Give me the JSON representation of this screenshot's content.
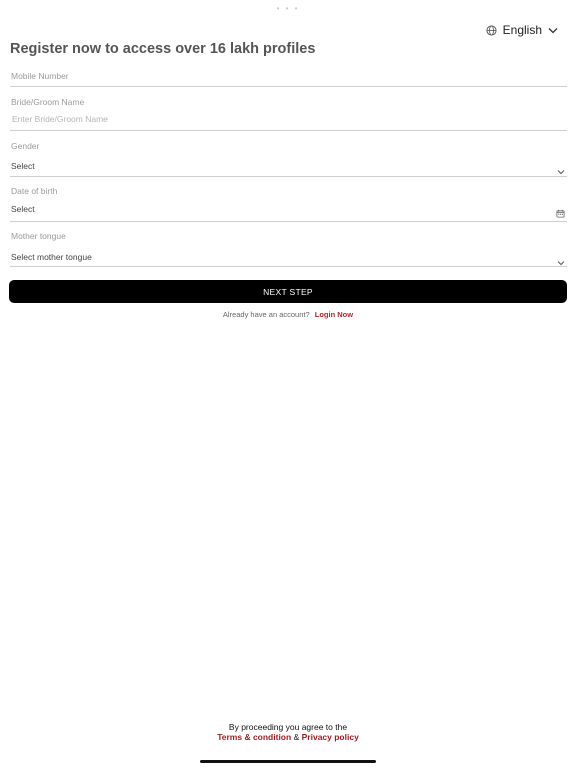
{
  "header": {
    "language": "English"
  },
  "page": {
    "title": "Register now to access over 16 lakh profiles"
  },
  "form": {
    "mobile": {
      "label": "Mobile Number"
    },
    "name": {
      "label": "Bride/Groom Name",
      "placeholder": "Enter Bride/Groom Name"
    },
    "gender": {
      "label": "Gender",
      "value": "Select"
    },
    "dob": {
      "label": "Date of birth",
      "value": "Select"
    },
    "mother_tongue": {
      "label": "Mother tongue",
      "value": "Select mother tongue"
    },
    "next_label": "NEXT STEP"
  },
  "login": {
    "prompt": "Already have an account?",
    "link": "Login Now"
  },
  "footer": {
    "agree_text": "By proceeding you agree to the",
    "terms": "Terms & condition",
    "amp": "&",
    "privacy": "Privacy policy"
  },
  "icons": {
    "language": "globe-icon",
    "language_toggle": "chevron-down-icon",
    "gender_toggle": "chevron-down-icon",
    "dob_picker": "calendar-icon",
    "mother_tongue_toggle": "chevron-down-icon"
  },
  "colors": {
    "accent": "#b3262b",
    "button": "#000000"
  }
}
